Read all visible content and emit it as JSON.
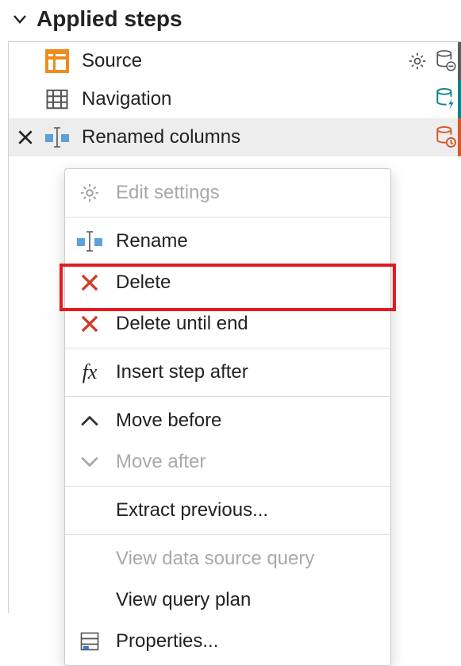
{
  "section": {
    "title": "Applied steps"
  },
  "steps": [
    {
      "label": "Source",
      "accent": "#5d5d5d"
    },
    {
      "label": "Navigation",
      "accent": "#0f8387"
    },
    {
      "label": "Renamed columns",
      "accent": "#d35a2a"
    }
  ],
  "contextMenu": {
    "items": [
      {
        "id": "edit-settings",
        "label": "Edit settings",
        "disabled": true,
        "icon": "gear"
      },
      {
        "sep": true
      },
      {
        "id": "rename",
        "label": "Rename",
        "icon": "rename"
      },
      {
        "id": "delete",
        "label": "Delete",
        "icon": "xred",
        "highlight": true
      },
      {
        "id": "delete-until-end",
        "label": "Delete until end",
        "icon": "xred"
      },
      {
        "sep": true
      },
      {
        "id": "insert-step-after",
        "label": "Insert step after",
        "icon": "fx"
      },
      {
        "sep": true
      },
      {
        "id": "move-before",
        "label": "Move before",
        "icon": "chev-up"
      },
      {
        "id": "move-after",
        "label": "Move after",
        "disabled": true,
        "icon": "chev-down"
      },
      {
        "sep": true
      },
      {
        "id": "extract-previous",
        "label": "Extract previous..."
      },
      {
        "sep": true
      },
      {
        "id": "view-data-source-query",
        "label": "View data source query",
        "disabled": true
      },
      {
        "id": "view-query-plan",
        "label": "View query plan"
      },
      {
        "id": "properties",
        "label": "Properties...",
        "icon": "props"
      }
    ]
  }
}
